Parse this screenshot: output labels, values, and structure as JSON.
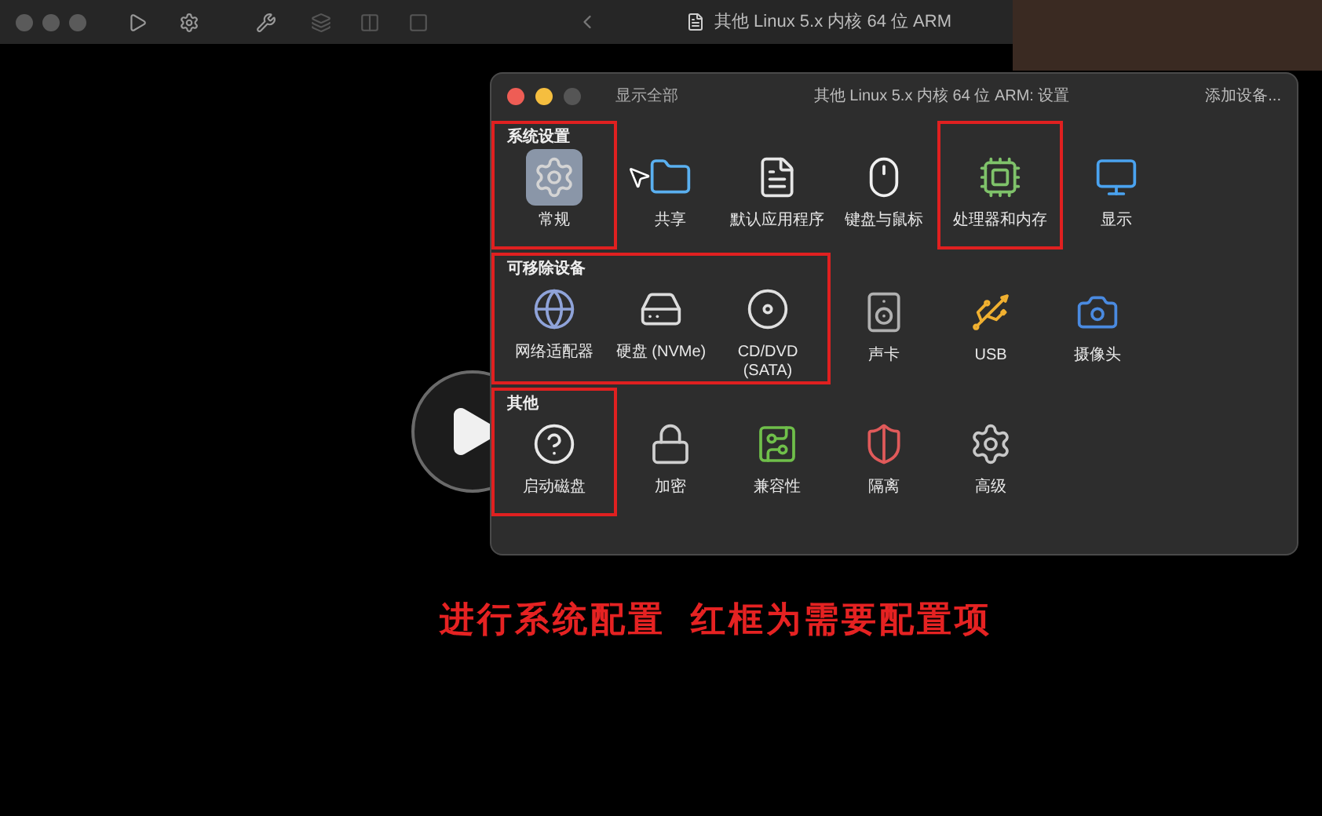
{
  "toolbar": {
    "title": "其他 Linux 5.x 内核 64 位 ARM"
  },
  "dialog": {
    "show_all": "显示全部",
    "title": "其他 Linux 5.x 内核 64 位 ARM: 设置",
    "add_device": "添加设备...",
    "sections": [
      {
        "title": "系统设置",
        "highlighted": true,
        "items": [
          {
            "label": "常规",
            "highlighted": true,
            "selected": true
          },
          {
            "label": "共享",
            "highlighted": false,
            "selected": false
          },
          {
            "label": "默认应用程序",
            "highlighted": false,
            "selected": false
          },
          {
            "label": "键盘与鼠标",
            "highlighted": false,
            "selected": false
          },
          {
            "label": "处理器和内存",
            "highlighted": true,
            "selected": false
          },
          {
            "label": "显示",
            "highlighted": false,
            "selected": false
          }
        ]
      },
      {
        "title": "可移除设备",
        "highlighted": true,
        "items": [
          {
            "label": "网络适配器",
            "highlighted": true,
            "selected": false
          },
          {
            "label": "硬盘 (NVMe)",
            "highlighted": true,
            "selected": false
          },
          {
            "label": "CD/DVD (SATA)",
            "highlighted": true,
            "selected": false
          },
          {
            "label": "声卡",
            "highlighted": false,
            "selected": false
          },
          {
            "label": "USB",
            "highlighted": false,
            "selected": false
          },
          {
            "label": "摄像头",
            "highlighted": false,
            "selected": false
          }
        ]
      },
      {
        "title": "其他",
        "highlighted": true,
        "items": [
          {
            "label": "启动磁盘",
            "highlighted": true,
            "selected": false
          },
          {
            "label": "加密",
            "highlighted": false,
            "selected": false
          },
          {
            "label": "兼容性",
            "highlighted": false,
            "selected": false
          },
          {
            "label": "隔离",
            "highlighted": false,
            "selected": false
          },
          {
            "label": "高级",
            "highlighted": false,
            "selected": false
          }
        ]
      }
    ]
  },
  "caption": "进行系统配置  红框为需要配置项"
}
